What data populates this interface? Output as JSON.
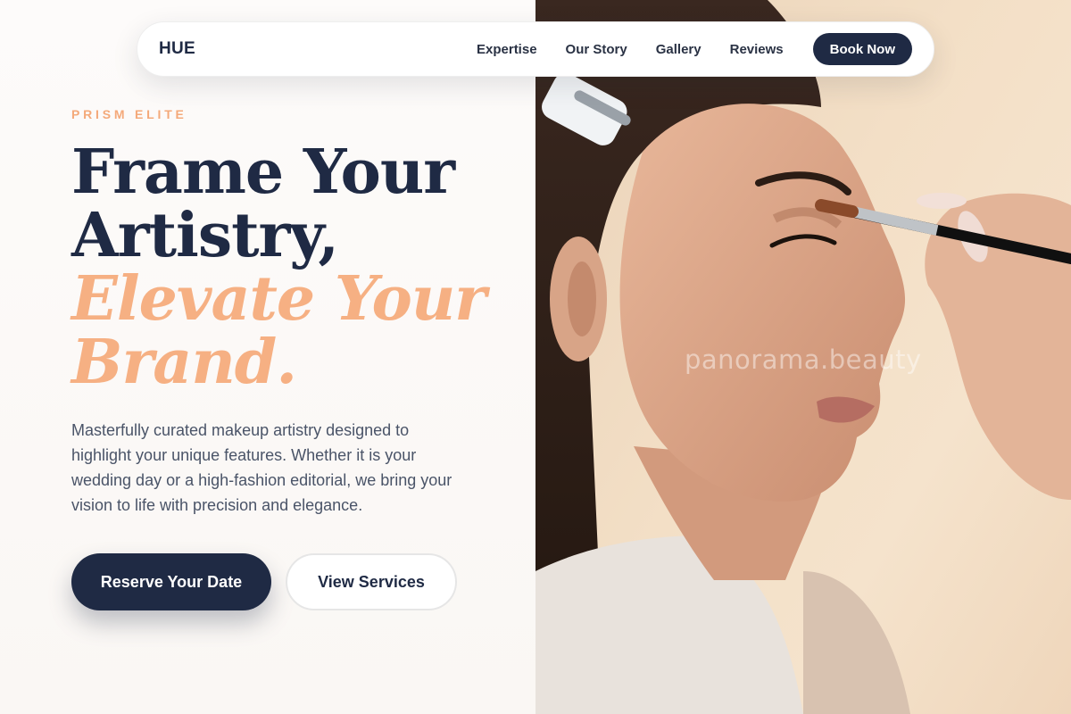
{
  "nav": {
    "logo": "HUE",
    "links": [
      "Expertise",
      "Our Story",
      "Gallery",
      "Reviews"
    ],
    "cta": "Book Now"
  },
  "hero": {
    "eyebrow": "PRISM ELITE",
    "headline_line1": "Frame Your",
    "headline_line2": "Artistry,",
    "headline_accent_line1": "Elevate Your",
    "headline_accent_line2": "Brand.",
    "description": "Masterfully curated makeup artistry designed to highlight your unique features. Whether it is your wedding day or a high-fashion editorial, we bring your vision to life with precision and elegance.",
    "primary_button": "Reserve Your Date",
    "secondary_button": "View Services"
  },
  "photo": {
    "watermark": "panorama.beauty"
  },
  "colors": {
    "navy": "#1f2a44",
    "accent_peach": "#f6b083",
    "eyebrow_peach": "#f4a97a",
    "body_text": "#4a5468"
  }
}
